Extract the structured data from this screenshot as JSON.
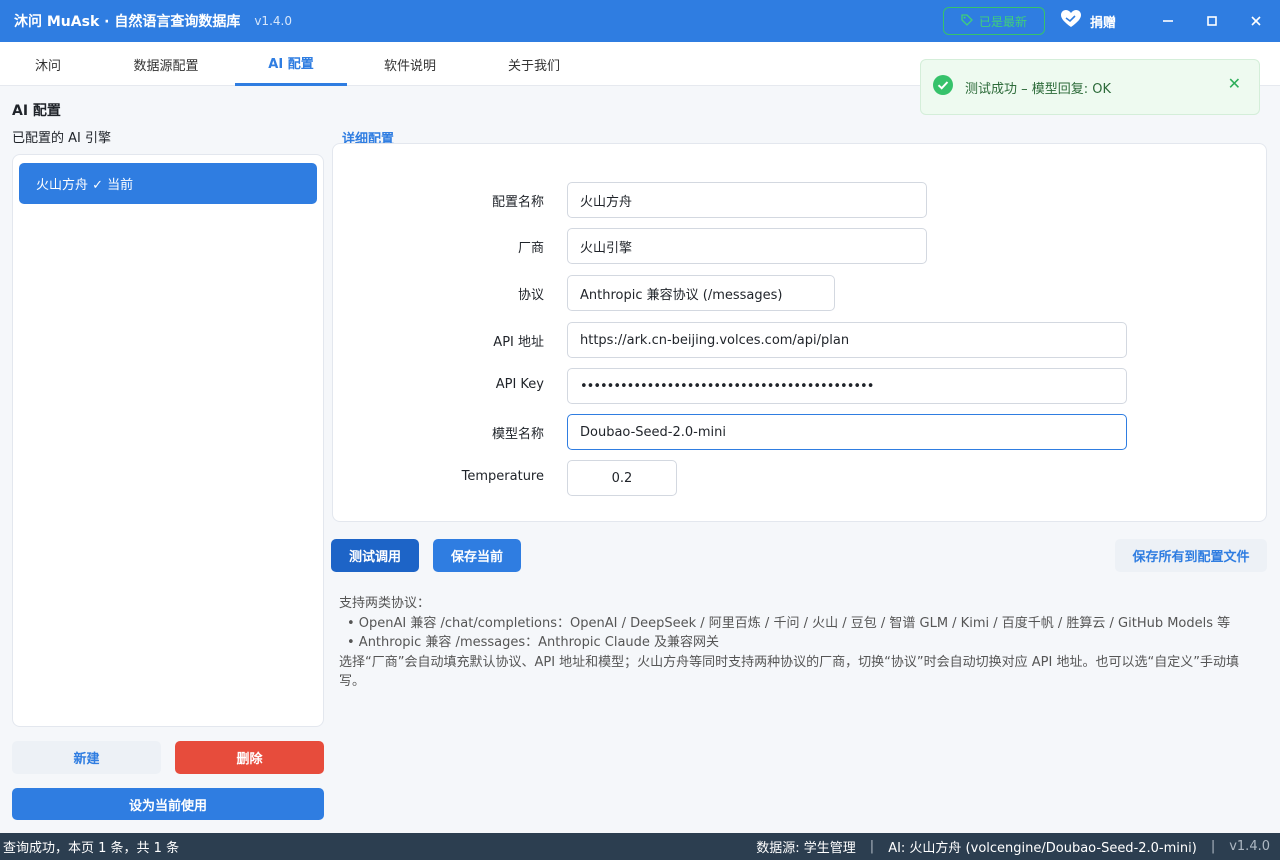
{
  "window": {
    "title": "沐问 MuAsk · 自然语言查询数据库",
    "version": "v1.4.0",
    "update_badge": "已是最新",
    "donate_label": "捐赠",
    "icons": {
      "tag": "tag-icon",
      "donate": "heart-hands-icon",
      "minimize": "minimize-icon",
      "maximize": "maximize-icon",
      "close": "close-icon"
    }
  },
  "tabs": [
    {
      "label": "沐问"
    },
    {
      "label": "数据源配置"
    },
    {
      "label": "AI 配置"
    },
    {
      "label": "软件说明"
    },
    {
      "label": "关于我们"
    }
  ],
  "toast": {
    "message": "测试成功 – 模型回复: OK"
  },
  "left": {
    "section_title": "AI 配置",
    "list_title": "已配置的 AI 引擎",
    "engines": [
      {
        "label": "火山方舟 ✓ 当前"
      }
    ],
    "new_button": "新建",
    "delete_button": "删除",
    "set_current_button": "设为当前使用"
  },
  "detail": {
    "section_label": "详细配置",
    "fields": {
      "name": {
        "label": "配置名称",
        "value": "火山方舟"
      },
      "vendor": {
        "label": "厂商",
        "value": "火山引擎"
      },
      "protocol": {
        "label": "协议",
        "value": "Anthropic 兼容协议 (/messages)"
      },
      "api_url": {
        "label": "API 地址",
        "value": "https://ark.cn-beijing.volces.com/api/plan"
      },
      "api_key": {
        "label": "API Key",
        "value": "••••••••••••••••••••••••••••••••••••••••••••"
      },
      "model": {
        "label": "模型名称",
        "value": "Doubao-Seed-2.0-mini"
      },
      "temperature": {
        "label": "Temperature",
        "value": "0.2"
      }
    },
    "test_button": "测试调用",
    "save_button": "保存当前",
    "save_all_button": "保存所有到配置文件"
  },
  "help": {
    "heading": "支持两类协议：",
    "bullet1": "• OpenAI 兼容 /chat/completions：OpenAI / DeepSeek / 阿里百炼 / 千问 / 火山 / 豆包 / 智谱 GLM / Kimi / 百度千帆 / 胜算云 / GitHub Models 等",
    "bullet2": "• Anthropic 兼容 /messages：Anthropic Claude 及兼容网关",
    "note": "选择“厂商”会自动填充默认协议、API 地址和模型；火山方舟等同时支持两种协议的厂商，切换“协议”时会自动切换对应 API 地址。也可以选“自定义”手动填写。"
  },
  "status": {
    "left": "查询成功，本页 1 条，共 1 条",
    "datasource": "数据源: 学生管理",
    "ai": "AI: 火山方舟 (volcengine/Doubao-Seed-2.0-mini)",
    "separator": "|",
    "version": "v1.4.0"
  },
  "colors": {
    "primary": "#2f7de1",
    "danger": "#e74c3c",
    "success": "#36c26b",
    "statusbar": "#2c3e50"
  }
}
